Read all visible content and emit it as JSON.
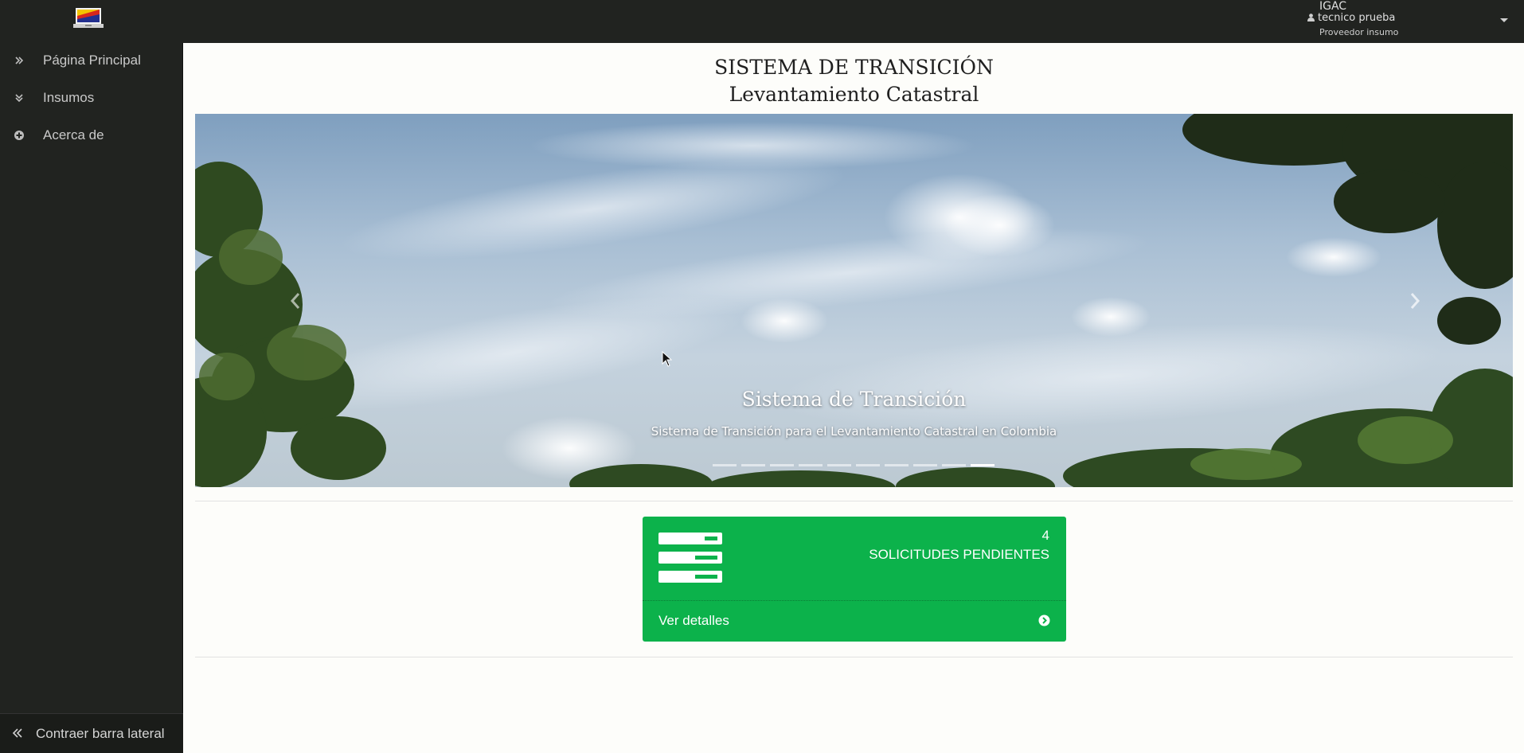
{
  "topbar": {
    "logo_icon": "laptop-flag-logo",
    "user": {
      "organization": "IGAC",
      "name": "tecnico prueba",
      "role": "Proveedor insumo",
      "user_icon": "user-icon",
      "menu_icon": "caret-down-icon"
    }
  },
  "sidebar": {
    "items": [
      {
        "label": "Página Principal",
        "icon": "double-chevron-right-icon"
      },
      {
        "label": "Insumos",
        "icon": "double-chevron-down-icon"
      },
      {
        "label": "Acerca de",
        "icon": "plus-circle-icon"
      }
    ],
    "collapse_label": "Contraer barra lateral",
    "collapse_icon": "double-chevron-left-icon"
  },
  "main": {
    "title": "SISTEMA DE TRANSICIÓN",
    "subtitle": "Levantamiento Catastral",
    "carousel": {
      "caption_title": "Sistema de Transición",
      "caption_text": "Sistema de Transición para el Levantamiento Catastral en Colombia",
      "slide_count": 10,
      "active_slide": 10,
      "prev_icon": "chevron-left-icon",
      "next_icon": "chevron-right-icon"
    },
    "panel": {
      "count": "4",
      "label": "SOLICITUDES PENDIENTES",
      "link_label": "Ver detalles",
      "icon": "server-list-icon",
      "link_icon": "arrow-circle-right-icon",
      "color": "#0cb24b"
    }
  }
}
